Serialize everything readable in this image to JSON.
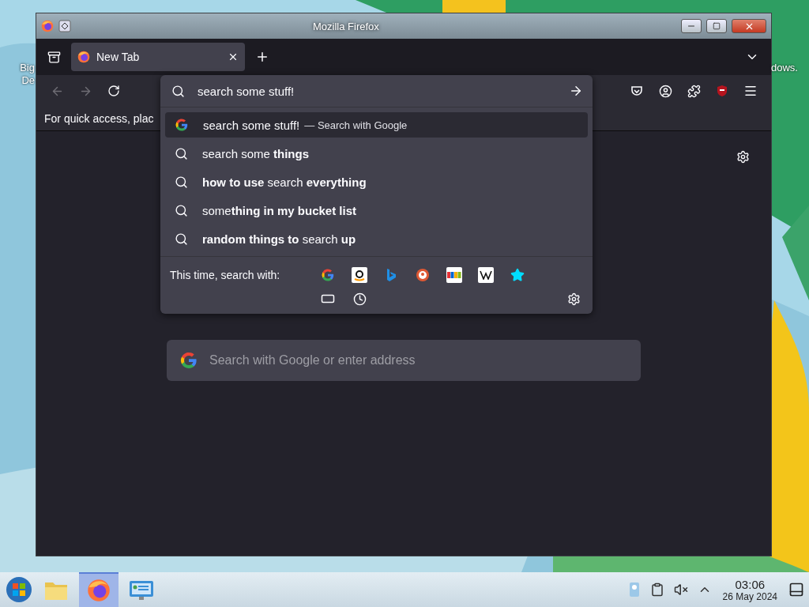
{
  "window": {
    "title": "Mozilla Firefox"
  },
  "desktop_labels_left": [
    "Big",
    "De"
  ],
  "desktop_labels_right": [
    "dows."
  ],
  "tabs": [
    {
      "label": "New Tab",
      "selected": true
    }
  ],
  "bookmarks_bar": {
    "text": "For quick access, plac"
  },
  "address_bar": {
    "value": "search some stuff!"
  },
  "suggestions": [
    {
      "kind": "engine",
      "text": "search some stuff!",
      "action": "— Search with Google",
      "selected": true
    },
    {
      "kind": "search",
      "text": "search some **things**",
      "selected": false
    },
    {
      "kind": "search",
      "text": "**how to use** search **everything**",
      "selected": false
    },
    {
      "kind": "search",
      "text": "some**thing in my bucket list**",
      "selected": false
    },
    {
      "kind": "search",
      "text": "**random things to** search **up**",
      "selected": false
    }
  ],
  "search_with": {
    "label": "This time, search with:"
  },
  "new_tab_search": {
    "placeholder": "Search with Google or enter address"
  },
  "taskbar": {
    "apps": [
      {
        "kind": "folder",
        "selected": false
      },
      {
        "kind": "firefox",
        "selected": true
      },
      {
        "kind": "monitor",
        "selected": false
      }
    ],
    "time": "03:06",
    "date": "26 May 2024"
  }
}
